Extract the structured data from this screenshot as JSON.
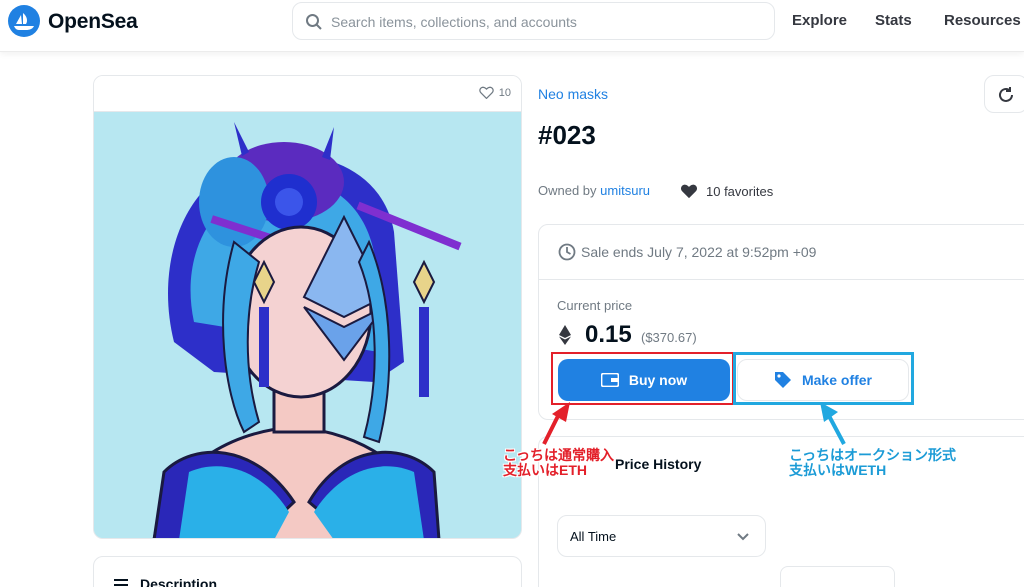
{
  "header": {
    "brand": "OpenSea",
    "search_placeholder": "Search items, collections, and accounts",
    "nav": [
      "Explore",
      "Stats",
      "Resources"
    ]
  },
  "item_card": {
    "favorite_count": "10",
    "description_label": "Description"
  },
  "item": {
    "collection": "Neo masks",
    "title": "#023",
    "owned_by_label": "Owned by",
    "owner": "umitsuru",
    "favorites": "10 favorites"
  },
  "sale": {
    "ends_text": "Sale ends July 7, 2022 at 9:52pm +09",
    "current_price_label": "Current price",
    "price": "0.15",
    "price_usd": "($370.67)",
    "buy_now_label": "Buy now",
    "make_offer_label": "Make offer"
  },
  "history": {
    "label": "Price History",
    "period": "All Time"
  },
  "annotations": {
    "left": "こっちは通常購入\n支払いはETH",
    "right": "こっちはオークション形式\n支払いはWETH"
  },
  "colors": {
    "accent": "#2081e2",
    "annotation_red": "#e3202a",
    "annotation_blue": "#21a8e0"
  }
}
